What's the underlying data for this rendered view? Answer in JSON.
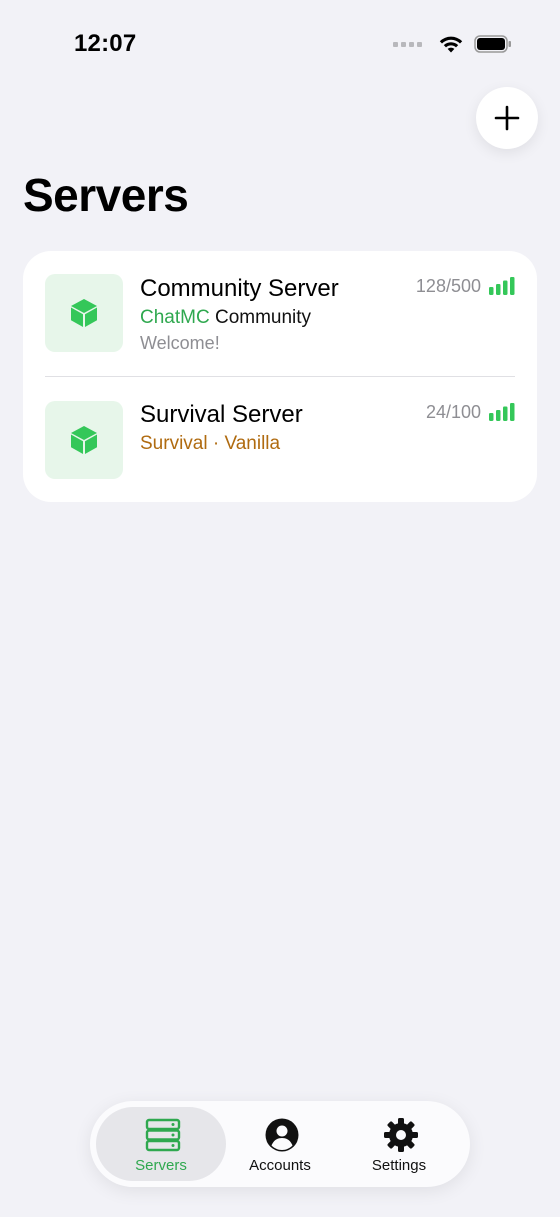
{
  "status_bar": {
    "time": "12:07"
  },
  "header": {
    "title": "Servers",
    "add_icon": "plus-icon"
  },
  "servers": [
    {
      "name": "Community Server",
      "motd_part1": "ChatMC",
      "motd_part2": " Community",
      "motd_line2": "Welcome!",
      "players": "128/500",
      "icon": "cube-icon",
      "ping_icon": "signal-bars-icon"
    },
    {
      "name": "Survival Server",
      "motd_part1": "Survival · Vanilla",
      "players": "24/100",
      "icon": "cube-icon",
      "ping_icon": "signal-bars-icon"
    }
  ],
  "tabs": [
    {
      "label": "Servers",
      "icon": "server-rack-icon",
      "active": true
    },
    {
      "label": "Accounts",
      "icon": "person-circle-icon",
      "active": false
    },
    {
      "label": "Settings",
      "icon": "gear-icon",
      "active": false
    }
  ],
  "colors": {
    "accent_green": "#2fa84f",
    "cube_green": "#34c759",
    "icon_bg": "#e7f6ea",
    "motd_gold": "#b06b10",
    "background": "#f2f2f7"
  }
}
